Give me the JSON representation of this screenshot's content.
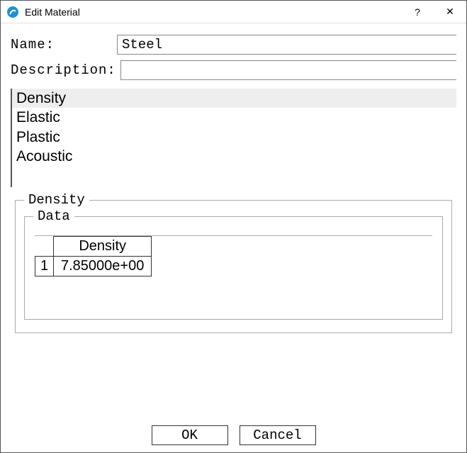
{
  "window": {
    "title": "Edit Material",
    "help_symbol": "?",
    "close_symbol": "✕"
  },
  "form": {
    "name_label": "Name:",
    "name_value": "Steel",
    "description_label": "Description:",
    "description_value": ""
  },
  "property_list": {
    "items": [
      "Density",
      "Elastic",
      "Plastic",
      "Acoustic"
    ],
    "selected_index": 0
  },
  "density_panel": {
    "legend": "Density",
    "data_legend": "Data",
    "table": {
      "col_header": "Density",
      "row_header": "1",
      "cell_value": "7.85000e+00"
    }
  },
  "buttons": {
    "ok": "OK",
    "cancel": "Cancel"
  }
}
